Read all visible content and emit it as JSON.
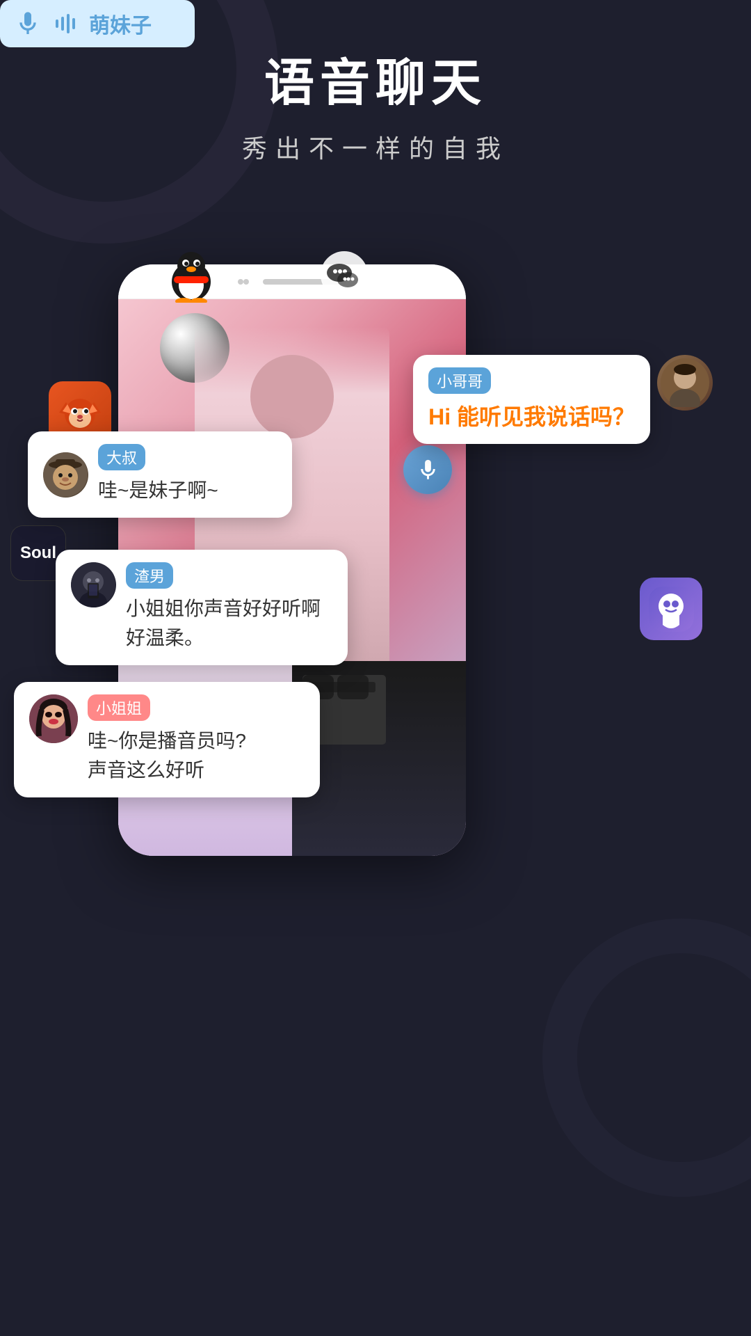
{
  "background": {
    "color": "#1e1f2e"
  },
  "title": {
    "main": "语音聊天",
    "sub": "秀出不一样的自我"
  },
  "bubbles": {
    "mengmeizi": {
      "name": "萌妹子",
      "nameColor": "#5ba3d9"
    },
    "xiaogege": {
      "name": "小哥哥",
      "nameColor": "#5ba3d9",
      "text": "Hi 能听见我说话吗？"
    },
    "dashu": {
      "name": "大叔",
      "nameColor": "#5ba3d9",
      "text": "哇~是妹子啊~"
    },
    "zhenan": {
      "name": "渣男",
      "nameColor": "#5ba3d9",
      "text": "小姐姐你声音好好听啊\n好温柔。"
    },
    "xiaojiejie": {
      "name": "小姐姐",
      "nameColor": "#ff8888",
      "text": "哇~你是播音员吗?\n声音这么好听"
    }
  },
  "apps": {
    "soul": "Soul",
    "qq": "🐧",
    "wechat": "💬"
  }
}
